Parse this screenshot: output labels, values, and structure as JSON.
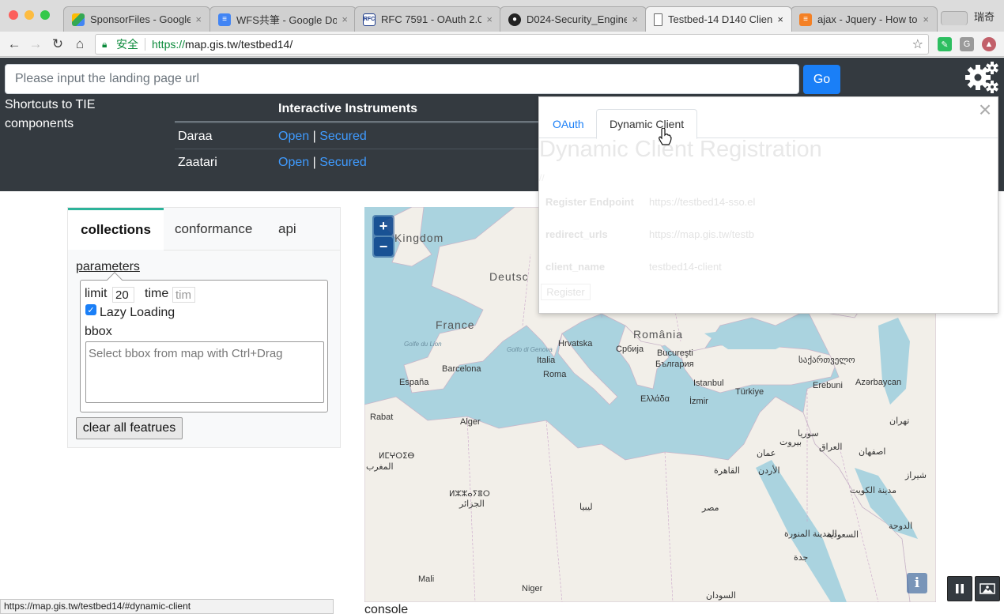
{
  "browser": {
    "tabs": [
      {
        "title": "SponsorFiles - Google",
        "icon": "google-drive-icon"
      },
      {
        "title": "WFS共筆 - Google Doc",
        "icon": "google-docs-icon"
      },
      {
        "title": "RFC 7591 - OAuth 2.0 D",
        "icon": "rfc-icon"
      },
      {
        "title": "D024-Security_Enginee",
        "icon": "github-icon"
      },
      {
        "title": "Testbed-14 D140 Clien",
        "icon": "page-icon"
      },
      {
        "title": "ajax - Jquery - How to",
        "icon": "stackoverflow-icon"
      }
    ],
    "profile_name": "瑞奇",
    "secure_label": "安全",
    "url_scheme": "https://",
    "url_host": "map.gis.tw",
    "url_path": "/testbed14/",
    "status_url": "https://map.gis.tw/testbed14/#dynamic-client"
  },
  "header": {
    "landing_placeholder": "Please input the landing page url",
    "go_label": "Go",
    "shortcuts_line1": "Shortcuts to TIE",
    "shortcuts_line2": "components",
    "instruments_header": "Interactive Instruments",
    "rows": [
      {
        "name": "Daraa",
        "open": "Open",
        "sep": "|",
        "secured": "Secured"
      },
      {
        "name": "Zaatari",
        "open": "Open",
        "sep": "|",
        "secured": "Secured"
      }
    ]
  },
  "left_panel": {
    "tabs": [
      "collections",
      "conformance",
      "api"
    ],
    "parameters_label": "parameters",
    "limit_label": "limit",
    "limit_value": "20",
    "time_label": "time",
    "time_placeholder": "tim",
    "lazy_label": "Lazy Loading",
    "lazy_checked": true,
    "bbox_label": "bbox",
    "bbox_placeholder": "Select bbox from map with Ctrl+Drag",
    "clear_label": "clear all featrues"
  },
  "map": {
    "zoom_in": "+",
    "zoom_out": "−",
    "info": "i",
    "labels": [
      "Kingdom",
      "Deutsc",
      "France",
      "România",
      "Hrvatska",
      "Србија",
      "Bucureşti",
      "България",
      "Italia",
      "Roma",
      "Barcelona",
      "España",
      "Istanbul",
      "Türkiye",
      "Ελλάδα",
      "İzmir",
      "საქართველო",
      "Erebuni",
      "Azərbaycan",
      "Rabat",
      "Alger",
      "Golfe du Lion",
      "Golfo di Genova",
      "المغرب",
      "الجزائر",
      "ليبيا",
      "مصر",
      "القاهرة",
      "الأردن",
      "سوريا",
      "العراق",
      "بيروت",
      "عمان",
      "تهران",
      "اصفهان",
      "شیراز",
      "مدينة الكويت",
      "الدوحة",
      "السعودية",
      "المدينة المنورة",
      "جدة",
      "Mali",
      "Niger",
      "السودان",
      "ⵍⵎⵖⵔⵉⴱ",
      "ⵍⵣⵣⴰⵢⴻⵔ"
    ]
  },
  "console_label": "console",
  "popup": {
    "tabs": [
      "OAuth",
      "Dynamic Client"
    ],
    "title": "Dynamic Client Registration",
    "subtitle": "//",
    "fields": [
      {
        "label": "Register Endpoint",
        "value": "https://testbed14-sso.el"
      },
      {
        "label": "redirect_urls",
        "value": "https://map.gis.tw/testb"
      },
      {
        "label": "client_name",
        "value": "testbed14-client"
      }
    ],
    "register_label": "Register",
    "close": "×"
  },
  "colors": {
    "accent": "#1a7ff7",
    "dark_band": "#343a40",
    "tab_underline": "#2db39a",
    "sea": "#aad3df",
    "land": "#f2efe9"
  }
}
